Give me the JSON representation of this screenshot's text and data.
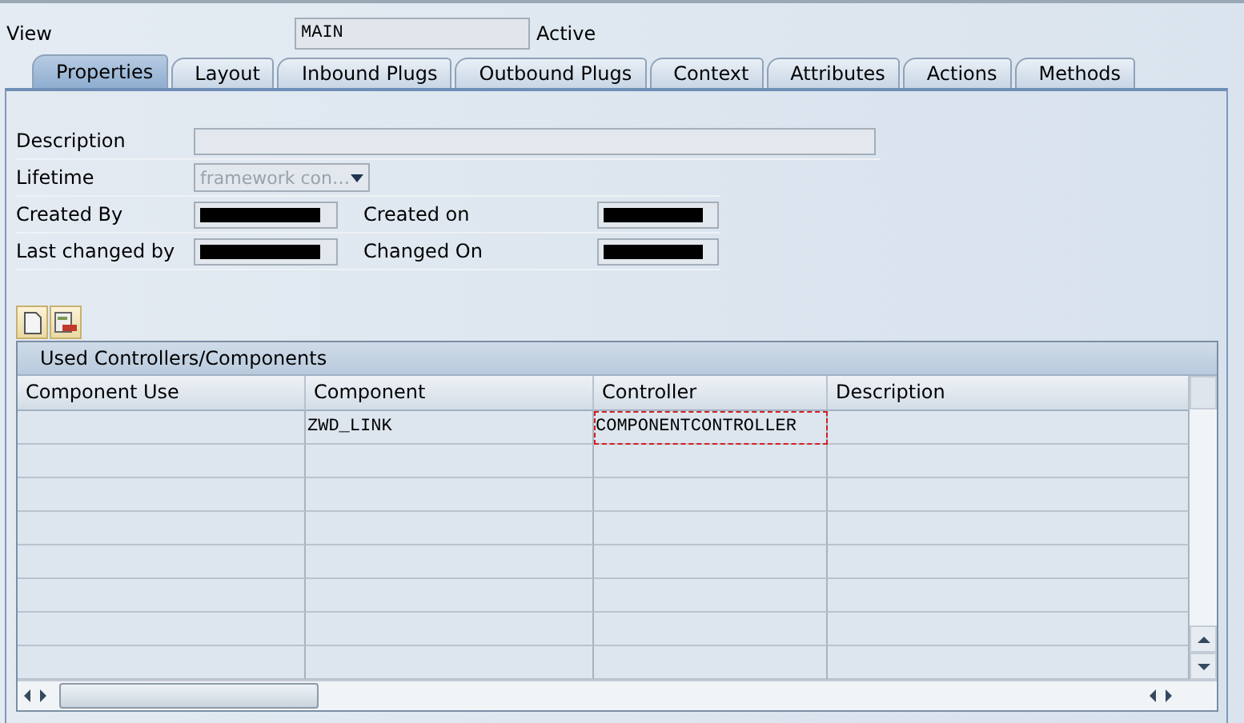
{
  "header": {
    "label": "View",
    "value": "MAIN",
    "status": "Active"
  },
  "tabs": [
    {
      "label": "Properties",
      "selected": true
    },
    {
      "label": "Layout",
      "selected": false
    },
    {
      "label": "Inbound Plugs",
      "selected": false
    },
    {
      "label": "Outbound Plugs",
      "selected": false
    },
    {
      "label": "Context",
      "selected": false
    },
    {
      "label": "Attributes",
      "selected": false
    },
    {
      "label": "Actions",
      "selected": false
    },
    {
      "label": "Methods",
      "selected": false
    }
  ],
  "description": {
    "label": "Description"
  },
  "lifetime": {
    "label": "Lifetime",
    "value": "framework con…",
    "disabled": true
  },
  "created_by": {
    "label": "Created By",
    "redacted": true
  },
  "created_on": {
    "label": "Created on",
    "redacted": true
  },
  "last_changed_by": {
    "label": "Last changed by",
    "redacted": true
  },
  "changed_on": {
    "label": "Changed On",
    "redacted": true
  },
  "table": {
    "title": "Used Controllers/Components",
    "columns": [
      "Component Use",
      "Component",
      "Controller",
      "Description"
    ],
    "rows": [
      {
        "cells": [
          null,
          {
            "text": "ZWD_LINK",
            "focused": false
          },
          {
            "text": "COMPONENTCONTROLLER",
            "focused": true
          },
          null
        ]
      }
    ]
  }
}
